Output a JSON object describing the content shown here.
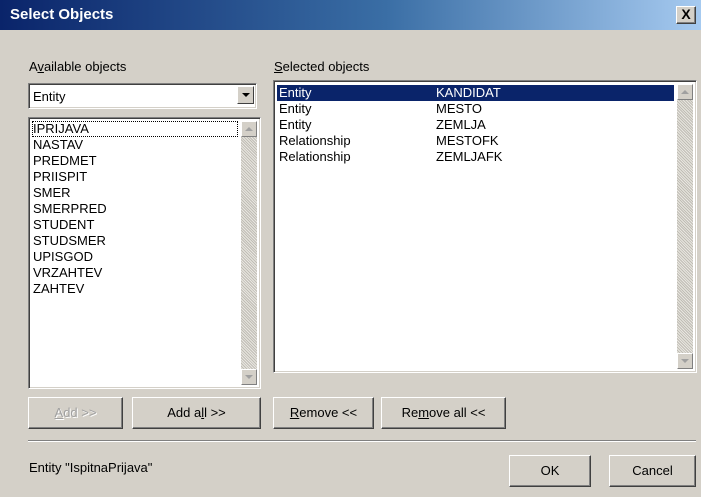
{
  "window": {
    "title": "Select Objects",
    "close_label": "X"
  },
  "available": {
    "label_pre": "A",
    "label_ul": "v",
    "label_post": "ailable objects",
    "type_selected": "Entity",
    "items": [
      {
        "label": "IPRIJAVA"
      },
      {
        "label": "NASTAV"
      },
      {
        "label": "PREDMET"
      },
      {
        "label": "PRIISPIT"
      },
      {
        "label": "SMER"
      },
      {
        "label": "SMERPRED"
      },
      {
        "label": "STUDENT"
      },
      {
        "label": "STUDSMER"
      },
      {
        "label": "UPISGOD"
      },
      {
        "label": "VRZAHTEV"
      },
      {
        "label": "ZAHTEV"
      }
    ]
  },
  "selected": {
    "label_ul": "S",
    "label_post": "elected objects",
    "rows": [
      {
        "kind": "Entity",
        "name": "KANDIDAT"
      },
      {
        "kind": "Entity",
        "name": "MESTO"
      },
      {
        "kind": "Entity",
        "name": "ZEMLJA"
      },
      {
        "kind": "Relationship",
        "name": "MESTOFK"
      },
      {
        "kind": "Relationship",
        "name": "ZEMLJAFK"
      }
    ]
  },
  "buttons": {
    "add_ul": "A",
    "add_post": "dd >>",
    "add_all_pre": "Add a",
    "add_all_ul": "l",
    "add_all_post": "l >>",
    "remove_ul": "R",
    "remove_post": "emove <<",
    "remove_all_pre": "Re",
    "remove_all_ul": "m",
    "remove_all_post": "ove all <<",
    "ok": "OK",
    "cancel": "Cancel"
  },
  "status": {
    "text": "Entity \"IspitnaPrijava\""
  },
  "colors": {
    "selection": "#0a246a",
    "face": "#d4d0c8",
    "title_start": "#0a246a",
    "title_end": "#a6caf0"
  }
}
